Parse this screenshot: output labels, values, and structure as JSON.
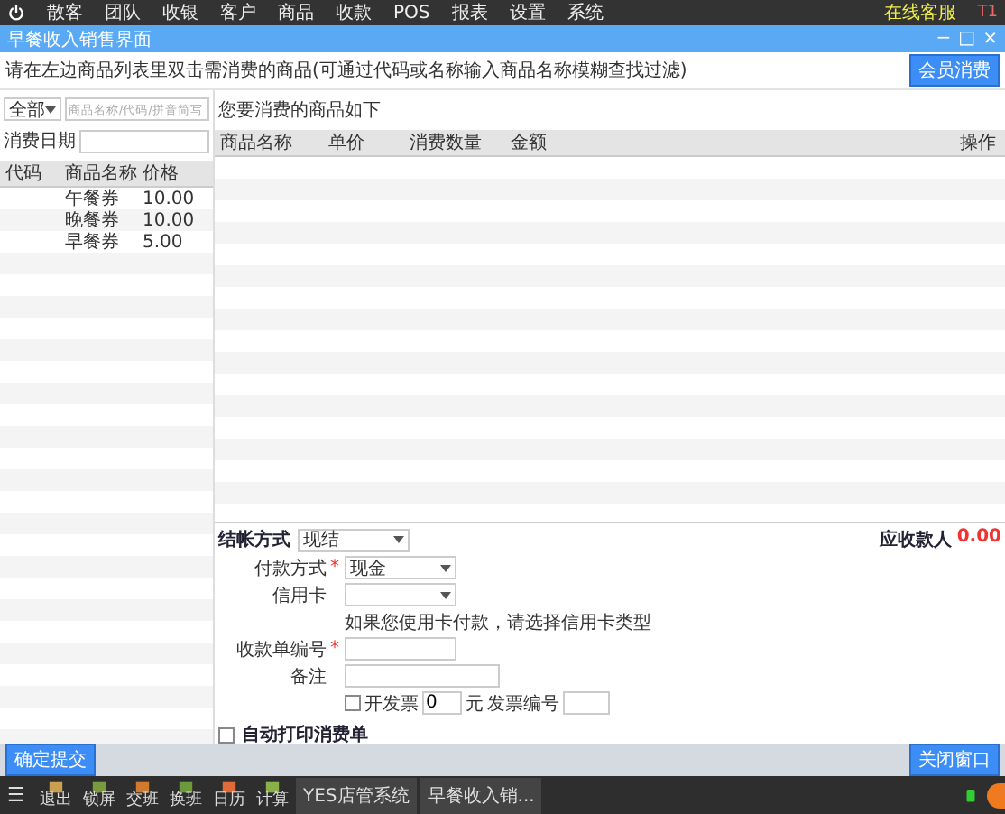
{
  "menu_bar": {
    "items": [
      "散客",
      "团队",
      "收银",
      "客户",
      "商品",
      "收款",
      "POS",
      "报表",
      "设置",
      "系统"
    ],
    "online": "在线客服",
    "user": "T1"
  },
  "window": {
    "title": "早餐收入销售界面",
    "controls": [
      "−",
      "□",
      "×"
    ]
  },
  "instruction": "请在左边商品列表里双击需消费的商品(可通过代码或名称输入商品名称模糊查找过滤)",
  "member_button": "会员消费",
  "filter": {
    "category": "全部",
    "search_placeholder": "商品名称/代码/拼音简写",
    "date_label": "消费日期"
  },
  "product_table": {
    "columns": [
      "代码",
      "商品名称",
      "价格"
    ],
    "rows": [
      {
        "code": "",
        "name": "午餐券",
        "price": "10.00"
      },
      {
        "code": "",
        "name": "晚餐券",
        "price": "10.00"
      },
      {
        "code": "",
        "name": "早餐券",
        "price": "5.00"
      }
    ]
  },
  "cart": {
    "title": "您要消费的商品如下",
    "columns": [
      "商品名称",
      "单价",
      "消费数量",
      "金额",
      "操作"
    ]
  },
  "payment": {
    "settle_label": "结帐方式",
    "settle_value": "现结",
    "method_label": "付款方式",
    "method_mark": "*",
    "method_value": "现金",
    "card_label": "信用卡",
    "card_hint": "如果您使用卡付款，请选择信用卡类型",
    "receipt_label": "收款单编号",
    "receipt_mark": "*",
    "note_label": "备注",
    "invoice": {
      "label": "开发票",
      "checked": false,
      "amount": "0",
      "unit": "元",
      "number_label": "发票编号"
    },
    "auto_print": {
      "label": "自动打印消费单",
      "checked": false
    },
    "due_label": "应收款人",
    "due_value": "0.00"
  },
  "footer": {
    "submit": "确定提交",
    "close": "关闭窗口"
  },
  "taskbar": {
    "menu": "☰",
    "apps": [
      {
        "label": "退出",
        "color": "#c8a050"
      },
      {
        "label": "锁屏",
        "color": "#7a9a40"
      },
      {
        "label": "交班",
        "color": "#d07a30"
      },
      {
        "label": "换班",
        "color": "#6a9a3a"
      },
      {
        "label": "日历",
        "color": "#e06a3a"
      },
      {
        "label": "计算",
        "color": "#8ab04a"
      }
    ],
    "tasks": [
      "YES店管系统",
      "早餐收入销..."
    ]
  }
}
